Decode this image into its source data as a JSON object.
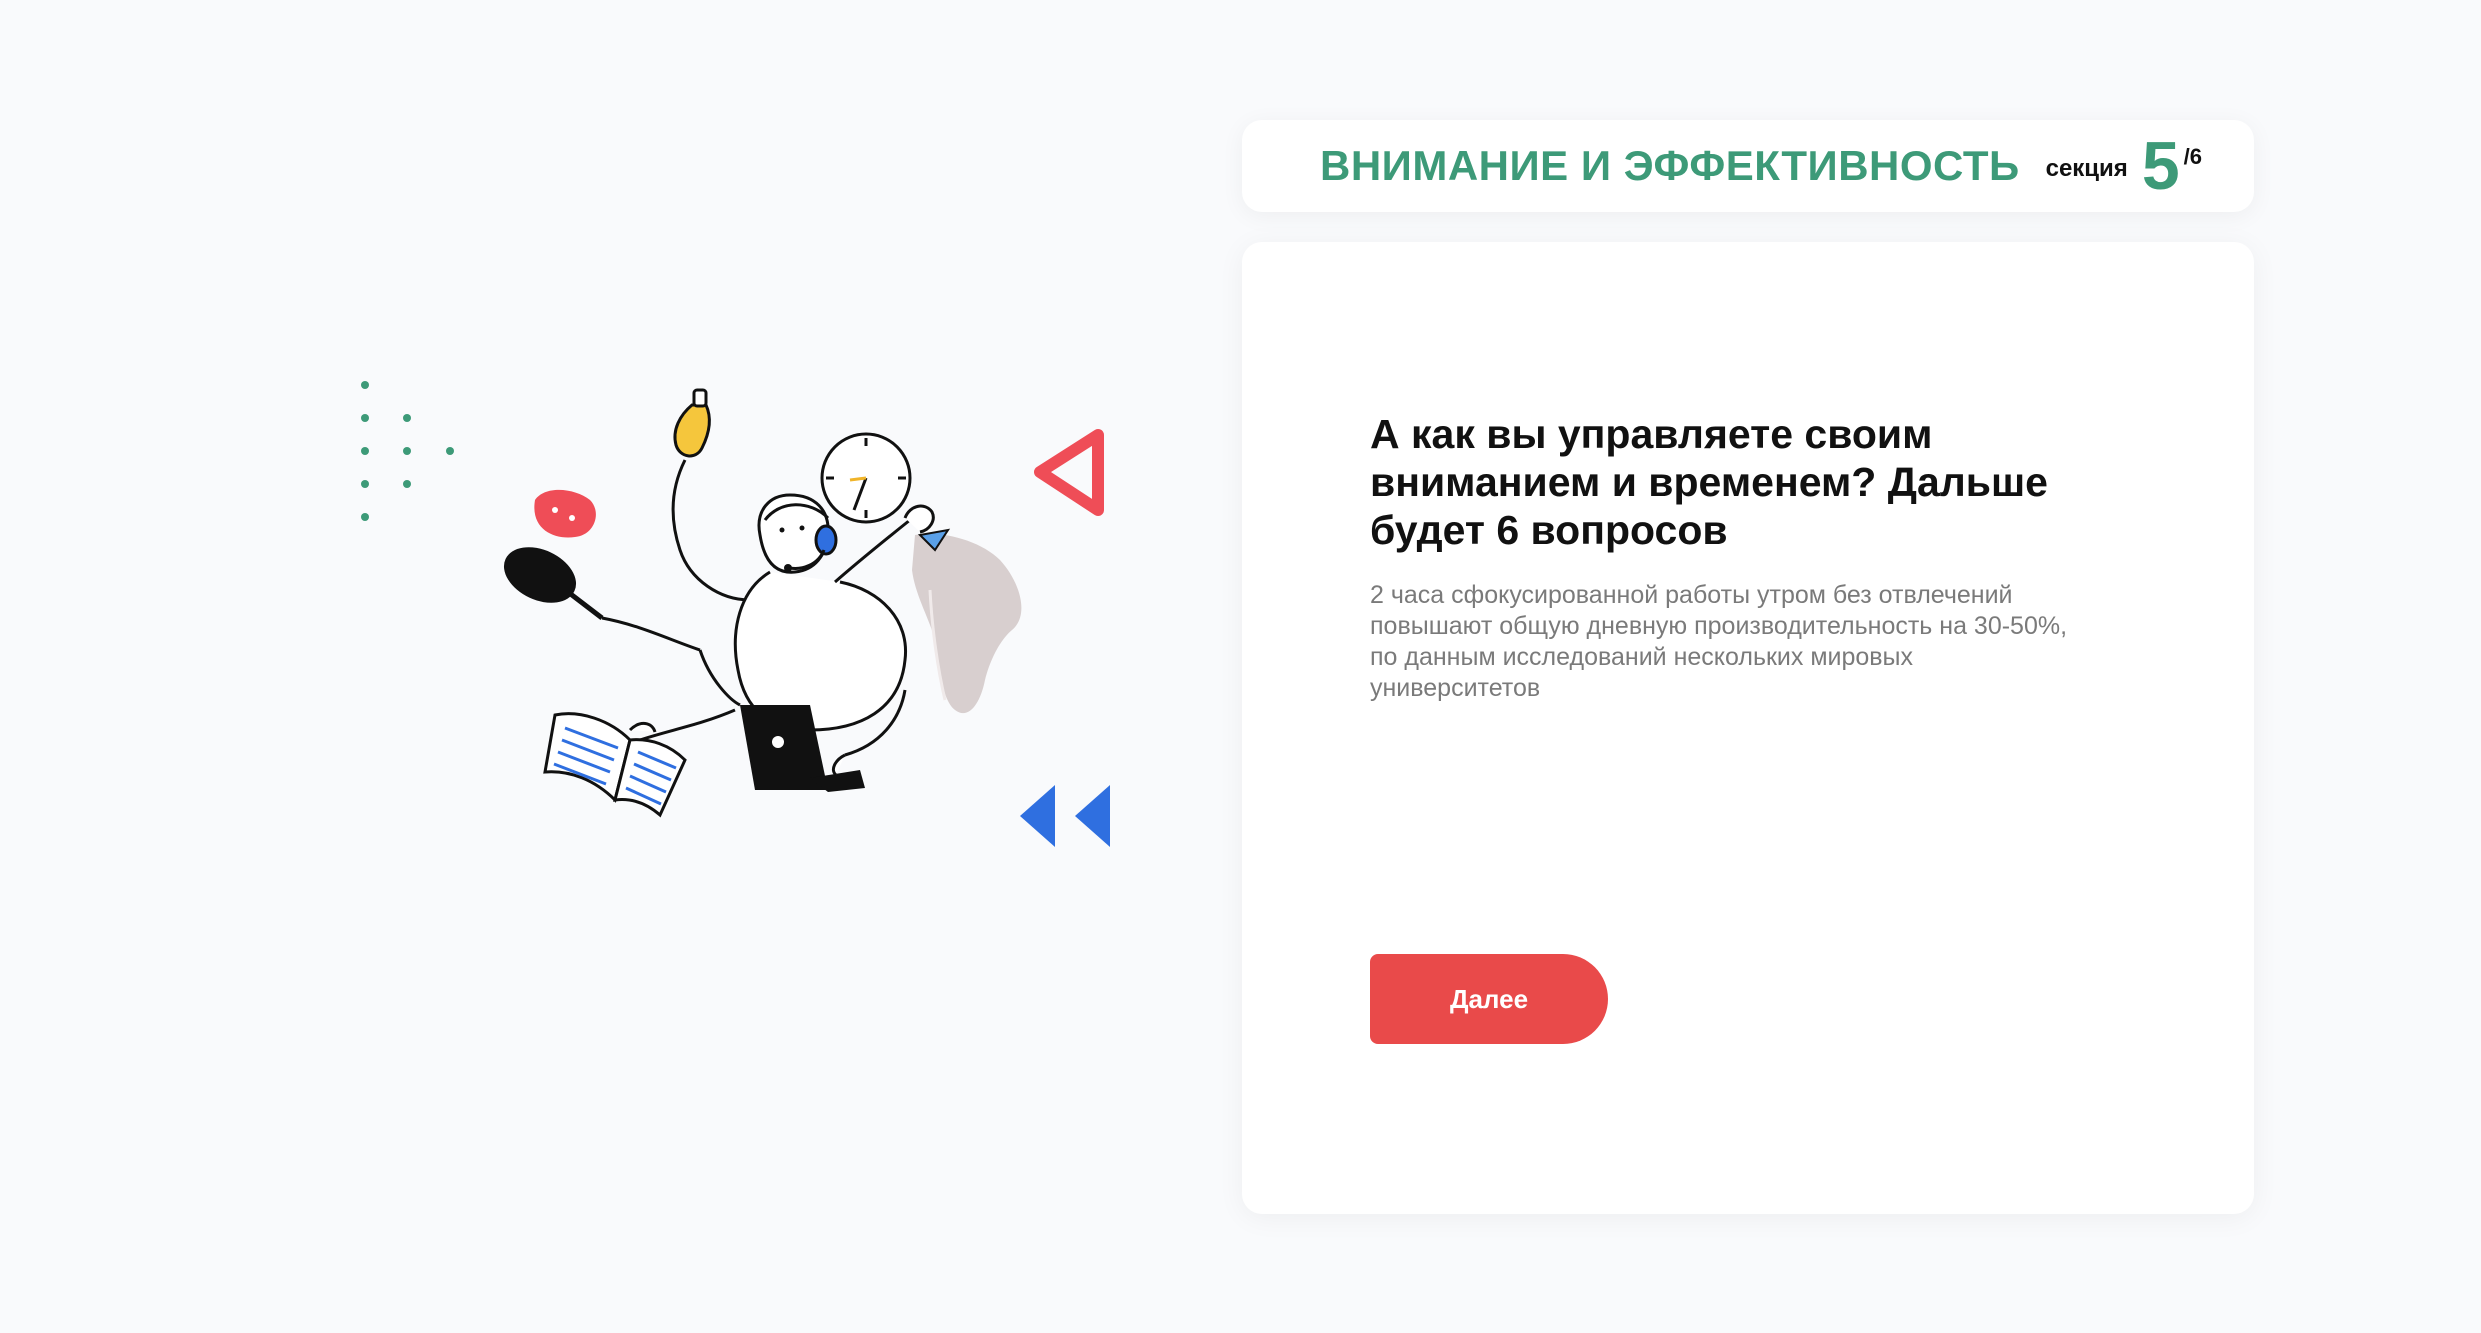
{
  "header": {
    "section_title": "ВНИМАНИЕ И ЭФФЕКТИВНОСТЬ",
    "section_word": "секция",
    "section_current": "5",
    "section_total": "/6"
  },
  "question": {
    "title": "А как вы управляете своим вниманием и временем? Дальше будет 6 вопросов",
    "description": "2 часа сфокусированной работы утром без отвлечений повышают общую дневную производительность на 30-50%, по данным исследований нескольких мировых университетов"
  },
  "actions": {
    "next_label": "Далее"
  },
  "colors": {
    "accent_green": "#3d9a78",
    "button_red": "#e94a4a",
    "triangle_red": "#ef4d57",
    "arrow_blue": "#2f6fe0"
  },
  "illustration": {
    "icons": [
      "multitasking-person-illustration",
      "clock-icon",
      "lightbulb-icon",
      "frying-pan-icon",
      "book-icon",
      "laptop-icon",
      "jacket-icon",
      "headset-icon",
      "dot-pattern",
      "triangle-outline-icon",
      "double-chevron-left-icon"
    ]
  }
}
